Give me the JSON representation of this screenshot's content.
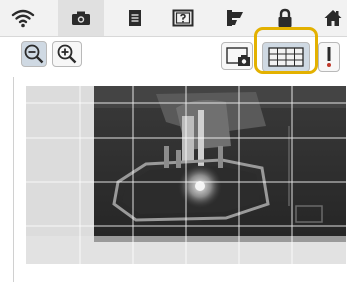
{
  "tabs": [
    {
      "icon": "wifi-icon"
    },
    {
      "icon": "camera-icon",
      "selected": true
    },
    {
      "icon": "document-icon"
    },
    {
      "icon": "help-frame-icon"
    },
    {
      "icon": "thread-spool-icon"
    },
    {
      "icon": "lock-icon"
    },
    {
      "icon": "home-icon"
    }
  ],
  "toolbar": {
    "zoom_out_icon": "zoom-out-icon",
    "zoom_in_icon": "zoom-in-icon",
    "camera_view_icon": "camera-view-icon",
    "grid_icon": "grid-icon",
    "needle_icon": "needle-position-icon",
    "grid_active": true
  },
  "camera_view": {
    "grid_columns": 6,
    "grid_rows": 5
  },
  "colors": {
    "highlight": "#e3b100",
    "active_button": "#cfd9e3",
    "icon": "#2b2b2b"
  }
}
